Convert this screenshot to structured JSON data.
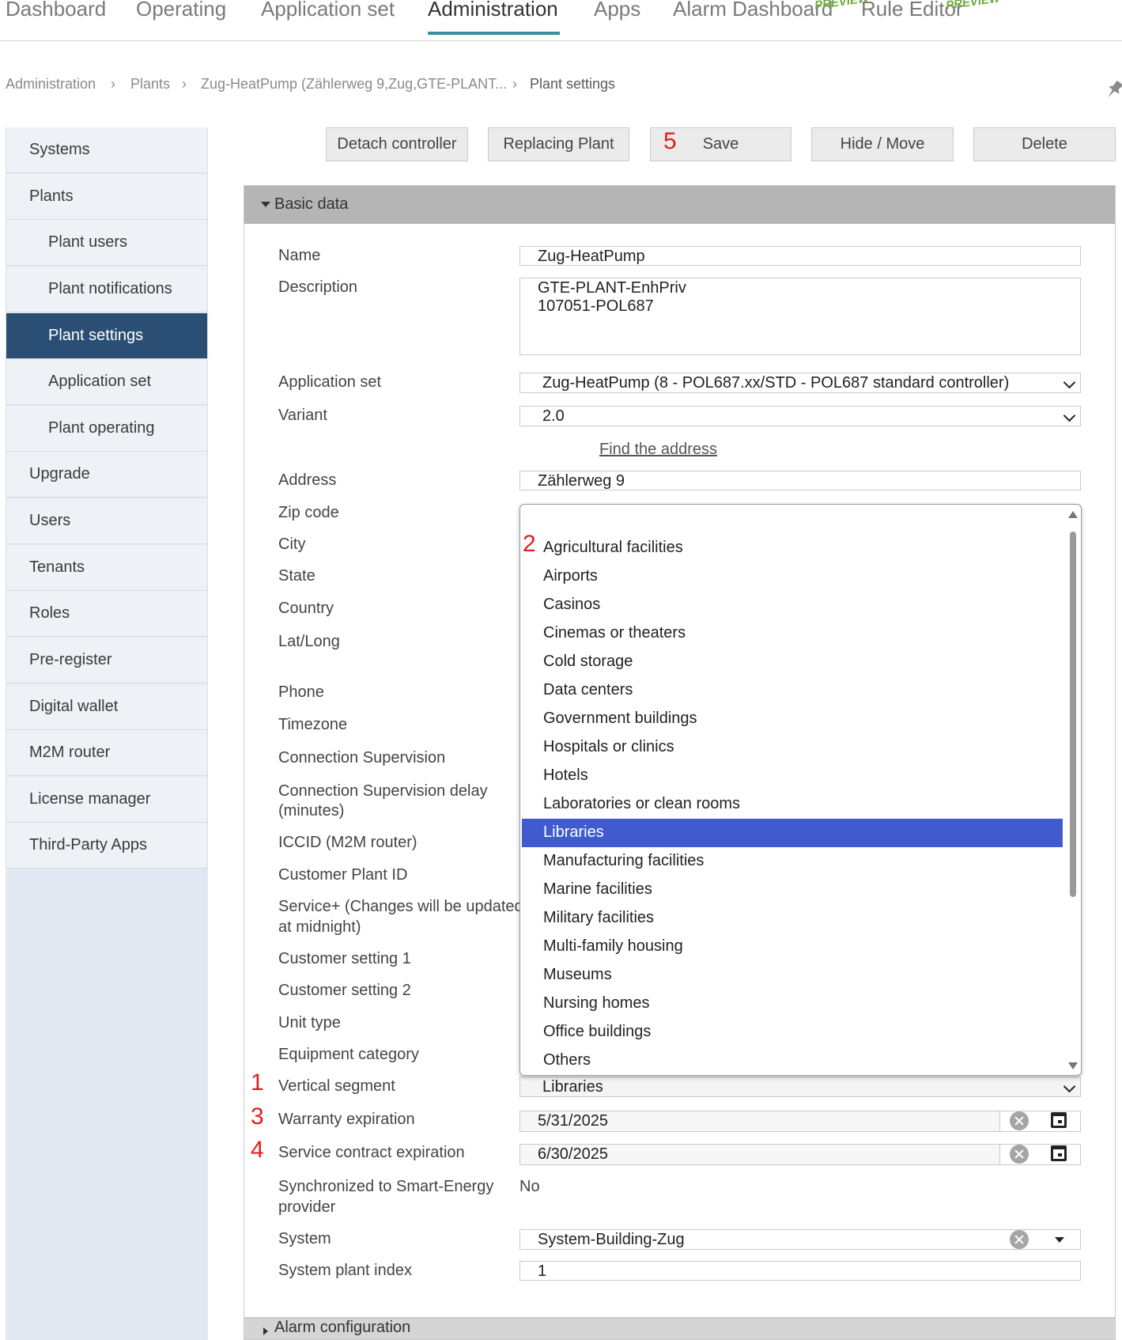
{
  "nav": {
    "tabs": [
      "Dashboard",
      "Operating",
      "Application set",
      "Administration",
      "Apps",
      "Alarm Dashboard",
      "Rule Editor"
    ],
    "active": "Administration",
    "preview_badge": "PREVIEW"
  },
  "breadcrumb": [
    "Administration",
    "Plants",
    "Zug-HeatPump (Zählerweg 9,Zug,GTE-PLANT...",
    "Plant settings"
  ],
  "sidebar": {
    "items": [
      {
        "label": "Systems",
        "level": 1
      },
      {
        "label": "Plants",
        "level": 1
      },
      {
        "label": "Plant users",
        "level": 2
      },
      {
        "label": "Plant notifications",
        "level": 2
      },
      {
        "label": "Plant settings",
        "level": 2,
        "active": true
      },
      {
        "label": "Application set",
        "level": 2
      },
      {
        "label": "Plant operating",
        "level": 2
      },
      {
        "label": "Upgrade",
        "level": 1
      },
      {
        "label": "Users",
        "level": 1
      },
      {
        "label": "Tenants",
        "level": 1
      },
      {
        "label": "Roles",
        "level": 1
      },
      {
        "label": "Pre-register",
        "level": 1
      },
      {
        "label": "Digital wallet",
        "level": 1
      },
      {
        "label": "M2M router",
        "level": 1
      },
      {
        "label": "License manager",
        "level": 1
      },
      {
        "label": "Third-Party Apps",
        "level": 1
      }
    ]
  },
  "actions": {
    "detach": "Detach controller",
    "replacing": "Replacing Plant",
    "save": "Save",
    "hide_move": "Hide / Move",
    "delete": "Delete"
  },
  "annotations": {
    "one": "1",
    "two": "2",
    "three": "3",
    "four": "4",
    "five": "5"
  },
  "basic_data": {
    "title": "Basic data",
    "labels": {
      "name": "Name",
      "description": "Description",
      "application_set": "Application set",
      "variant": "Variant",
      "address": "Address",
      "zip": "Zip code",
      "city": "City",
      "state": "State",
      "country": "Country",
      "latlong": "Lat/Long",
      "phone": "Phone",
      "timezone": "Timezone",
      "conn_sup": "Connection Supervision",
      "conn_delay_1": "Connection Supervision delay",
      "conn_delay_2": "(minutes)",
      "iccid": "ICCID (M2M router)",
      "cust_plant_id": "Customer Plant ID",
      "service_1": "Service+ (Changes will be updated",
      "service_2": "at midnight)",
      "cust_set1": "Customer setting 1",
      "cust_set2": "Customer setting 2",
      "unit_type": "Unit type",
      "equip_cat": "Equipment category",
      "vertical": "Vertical segment",
      "warranty": "Warranty expiration",
      "service_contract": "Service contract expiration",
      "sync_1": "Synchronized to Smart-Energy",
      "sync_2": "provider",
      "system": "System",
      "system_index": "System plant index"
    },
    "values": {
      "name": "Zug-HeatPump",
      "description_1": "GTE-PLANT-EnhPriv",
      "description_2": "107051-POL687",
      "application_set": "Zug-HeatPump (8 - POL687.xx/STD - POL687 standard controller)",
      "variant": "2.0",
      "find_address": "Find the address",
      "address": "Zählerweg 9",
      "vertical": "Libraries",
      "warranty": "5/31/2025",
      "service_contract": "6/30/2025",
      "sync": "No",
      "system": "System-Building-Zug",
      "system_index": "1"
    }
  },
  "dropdown": {
    "options": [
      "Agricultural facilities",
      "Airports",
      "Casinos",
      "Cinemas or theaters",
      "Cold storage",
      "Data centers",
      "Government buildings",
      "Hospitals or clinics",
      "Hotels",
      "Laboratories or clean rooms",
      "Libraries",
      "Manufacturing facilities",
      "Marine facilities",
      "Military facilities",
      "Multi-family housing",
      "Museums",
      "Nursing homes",
      "Office buildings",
      "Others"
    ],
    "selected": "Libraries"
  },
  "alarm_section": "Alarm configuration",
  "colors": {
    "accent": "#3a8f99",
    "sidebar_active": "#2b4f74",
    "dropdown_selected": "#3f5bcd",
    "annotation": "#e01e1e",
    "preview": "#6aae3c"
  }
}
